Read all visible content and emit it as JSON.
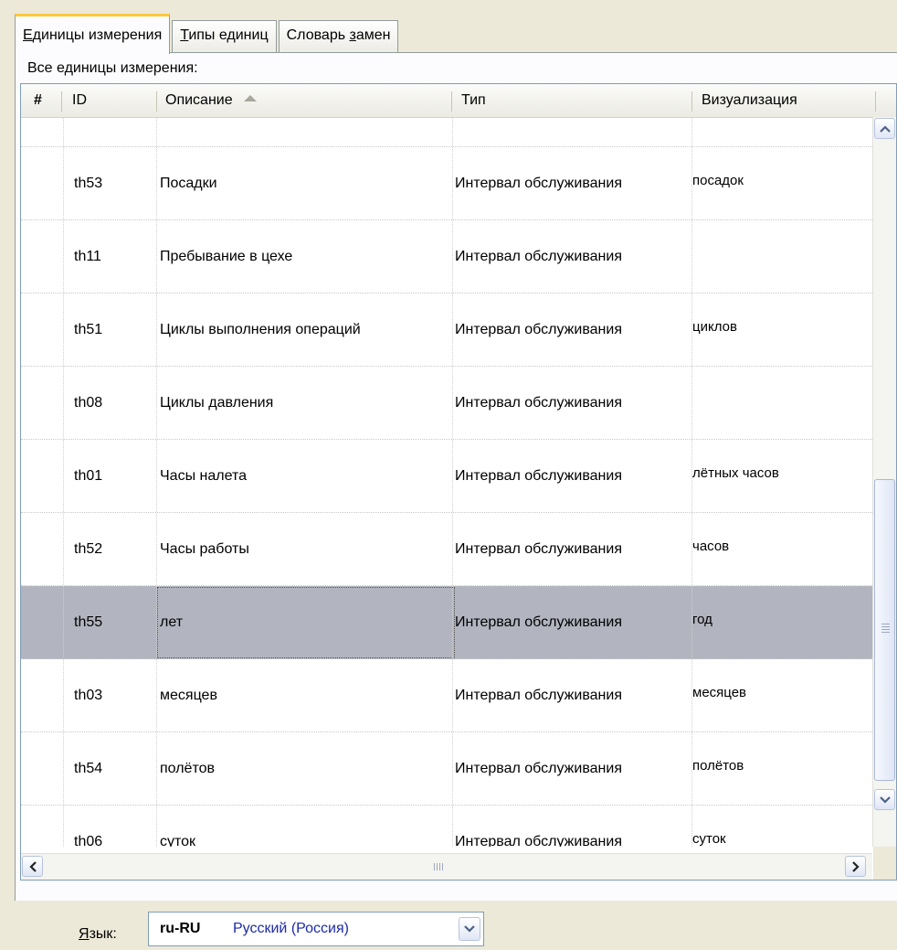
{
  "tabs": [
    {
      "label": "Единицы измерения",
      "active": true
    },
    {
      "label": "Типы единиц",
      "active": false
    },
    {
      "label": "Словарь замен",
      "active": false
    }
  ],
  "grid_caption": "Все единицы измерения:",
  "columns": {
    "num": "#",
    "id": "ID",
    "desc": "Описание",
    "type": "Тип",
    "vis": "Визуализация"
  },
  "rows": [
    {
      "id": "th53",
      "desc": "Посадки",
      "type": "Интервал обслуживания",
      "vis": "посадок"
    },
    {
      "id": "th11",
      "desc": "Пребывание в цехе",
      "type": "Интервал обслуживания",
      "vis": ""
    },
    {
      "id": "th51",
      "desc": "Циклы выполнения операций",
      "type": "Интервал обслуживания",
      "vis": "циклов"
    },
    {
      "id": "th08",
      "desc": "Циклы давления",
      "type": "Интервал обслуживания",
      "vis": ""
    },
    {
      "id": "th01",
      "desc": "Часы налета",
      "type": "Интервал обслуживания",
      "vis": "лётных  часов"
    },
    {
      "id": "th52",
      "desc": "Часы работы",
      "type": "Интервал обслуживания",
      "vis": "часов"
    },
    {
      "id": "th55",
      "desc": "лет",
      "type": "Интервал обслуживания",
      "vis": "год",
      "selected": true
    },
    {
      "id": "th03",
      "desc": "месяцев",
      "type": "Интервал обслуживания",
      "vis": "месяцев"
    },
    {
      "id": "th54",
      "desc": "полётов",
      "type": "Интервал обслуживания",
      "vis": "полётов"
    },
    {
      "id": "th06",
      "desc": "суток",
      "type": "Интервал обслуживания",
      "vis": "суток"
    }
  ],
  "language": {
    "label": "Язык:",
    "code": "ru-RU",
    "name": "Русский (Россия)"
  },
  "icons": {
    "sort": "sort-ascending-icon",
    "scroll_up": "chevron-up-icon",
    "scroll_down": "chevron-down-icon",
    "scroll_left": "chevron-left-icon",
    "scroll_right": "chevron-right-icon",
    "dropdown": "chevron-down-icon"
  },
  "colors": {
    "selected_row": "#b2b4bf",
    "active_tab_accent": "#ffc83c",
    "language_name": "#1d2aa8"
  }
}
